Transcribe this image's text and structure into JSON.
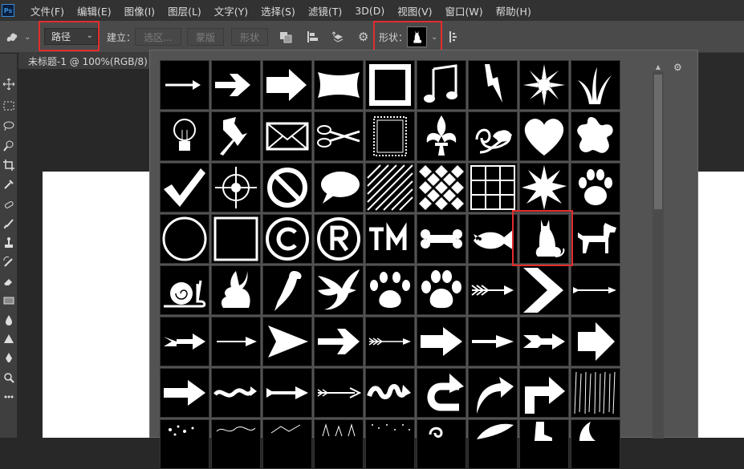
{
  "menubar": {
    "logo": "Ps",
    "items": [
      "文件(F)",
      "编辑(E)",
      "图像(I)",
      "图层(L)",
      "文字(Y)",
      "选择(S)",
      "滤镜(T)",
      "3D(D)",
      "视图(V)",
      "窗口(W)",
      "帮助(H)"
    ]
  },
  "options": {
    "mode_value": "路径",
    "make_label": "建立：",
    "selection_btn": "选区...",
    "mask_btn": "蒙版",
    "shape_btn": "形状",
    "shape_label": "形状："
  },
  "document": {
    "tab_title": "未标题-1 @ 100%(RGB/8)",
    "tab_close": "×"
  },
  "popup": {
    "gear": "⚙",
    "selected_shape": "cat",
    "shapes": [
      "arrow-thin",
      "arrow-bold",
      "arrow-block",
      "banner",
      "frame-rough",
      "music-notes",
      "lightning",
      "flower-burst",
      "grass",
      "lightbulb",
      "pushpin",
      "envelope",
      "scissors",
      "stamp-frame",
      "fleur-de-lis",
      "ornament-leaf",
      "heart",
      "ink-blot",
      "checkmark",
      "crosshair",
      "no-sign",
      "speech-bubble",
      "hatch-pattern",
      "diamond-checker",
      "grid",
      "starburst",
      "paw-print",
      "circle-frame",
      "square-frame",
      "copyright",
      "registered",
      "trademark",
      "bone",
      "fish",
      "cat",
      "dog",
      "snail",
      "rabbit",
      "parrot",
      "dove",
      "paw-print-2",
      "paw-print-3",
      "arrow-feathered",
      "chevron-right",
      "arrow-long",
      "arrow-tail",
      "arrow-line",
      "arrow-triangle",
      "arrow-wide",
      "arrow-feather-2",
      "arrow-fat",
      "arrow-sharp",
      "arrow-double-tail",
      "arrow-block-2",
      "arrow-right-fat",
      "arrow-wave",
      "arrow-simple",
      "arrow-sketch",
      "arrow-squiggle",
      "arrow-u-turn",
      "arrow-curved",
      "arrow-corner",
      "texture-lines"
    ]
  }
}
